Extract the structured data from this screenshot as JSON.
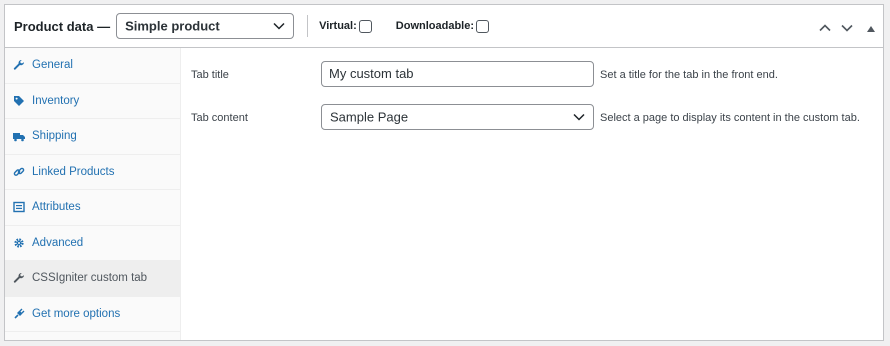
{
  "header": {
    "title": "Product data —",
    "product_type": "Simple product",
    "virtual_label": "Virtual:",
    "downloadable_label": "Downloadable:"
  },
  "sidebar": {
    "items": [
      {
        "label": "General",
        "icon": "wrench-icon"
      },
      {
        "label": "Inventory",
        "icon": "tag-icon"
      },
      {
        "label": "Shipping",
        "icon": "truck-icon"
      },
      {
        "label": "Linked Products",
        "icon": "link-icon"
      },
      {
        "label": "Attributes",
        "icon": "list-icon"
      },
      {
        "label": "Advanced",
        "icon": "gear-icon"
      },
      {
        "label": "CSSIgniter custom tab",
        "icon": "wrench-icon"
      },
      {
        "label": "Get more options",
        "icon": "plugin-icon"
      }
    ],
    "active_index": 6
  },
  "fields": {
    "tab_title": {
      "label": "Tab title",
      "value": "My custom tab",
      "description": "Set a title for the tab in the front end."
    },
    "tab_content": {
      "label": "Tab content",
      "value": "Sample Page",
      "description": "Select a page to display its content in the custom tab."
    }
  },
  "colors": {
    "link": "#2271b1",
    "border": "#c3c4c7",
    "active_tab_bg": "#eeeeee"
  }
}
